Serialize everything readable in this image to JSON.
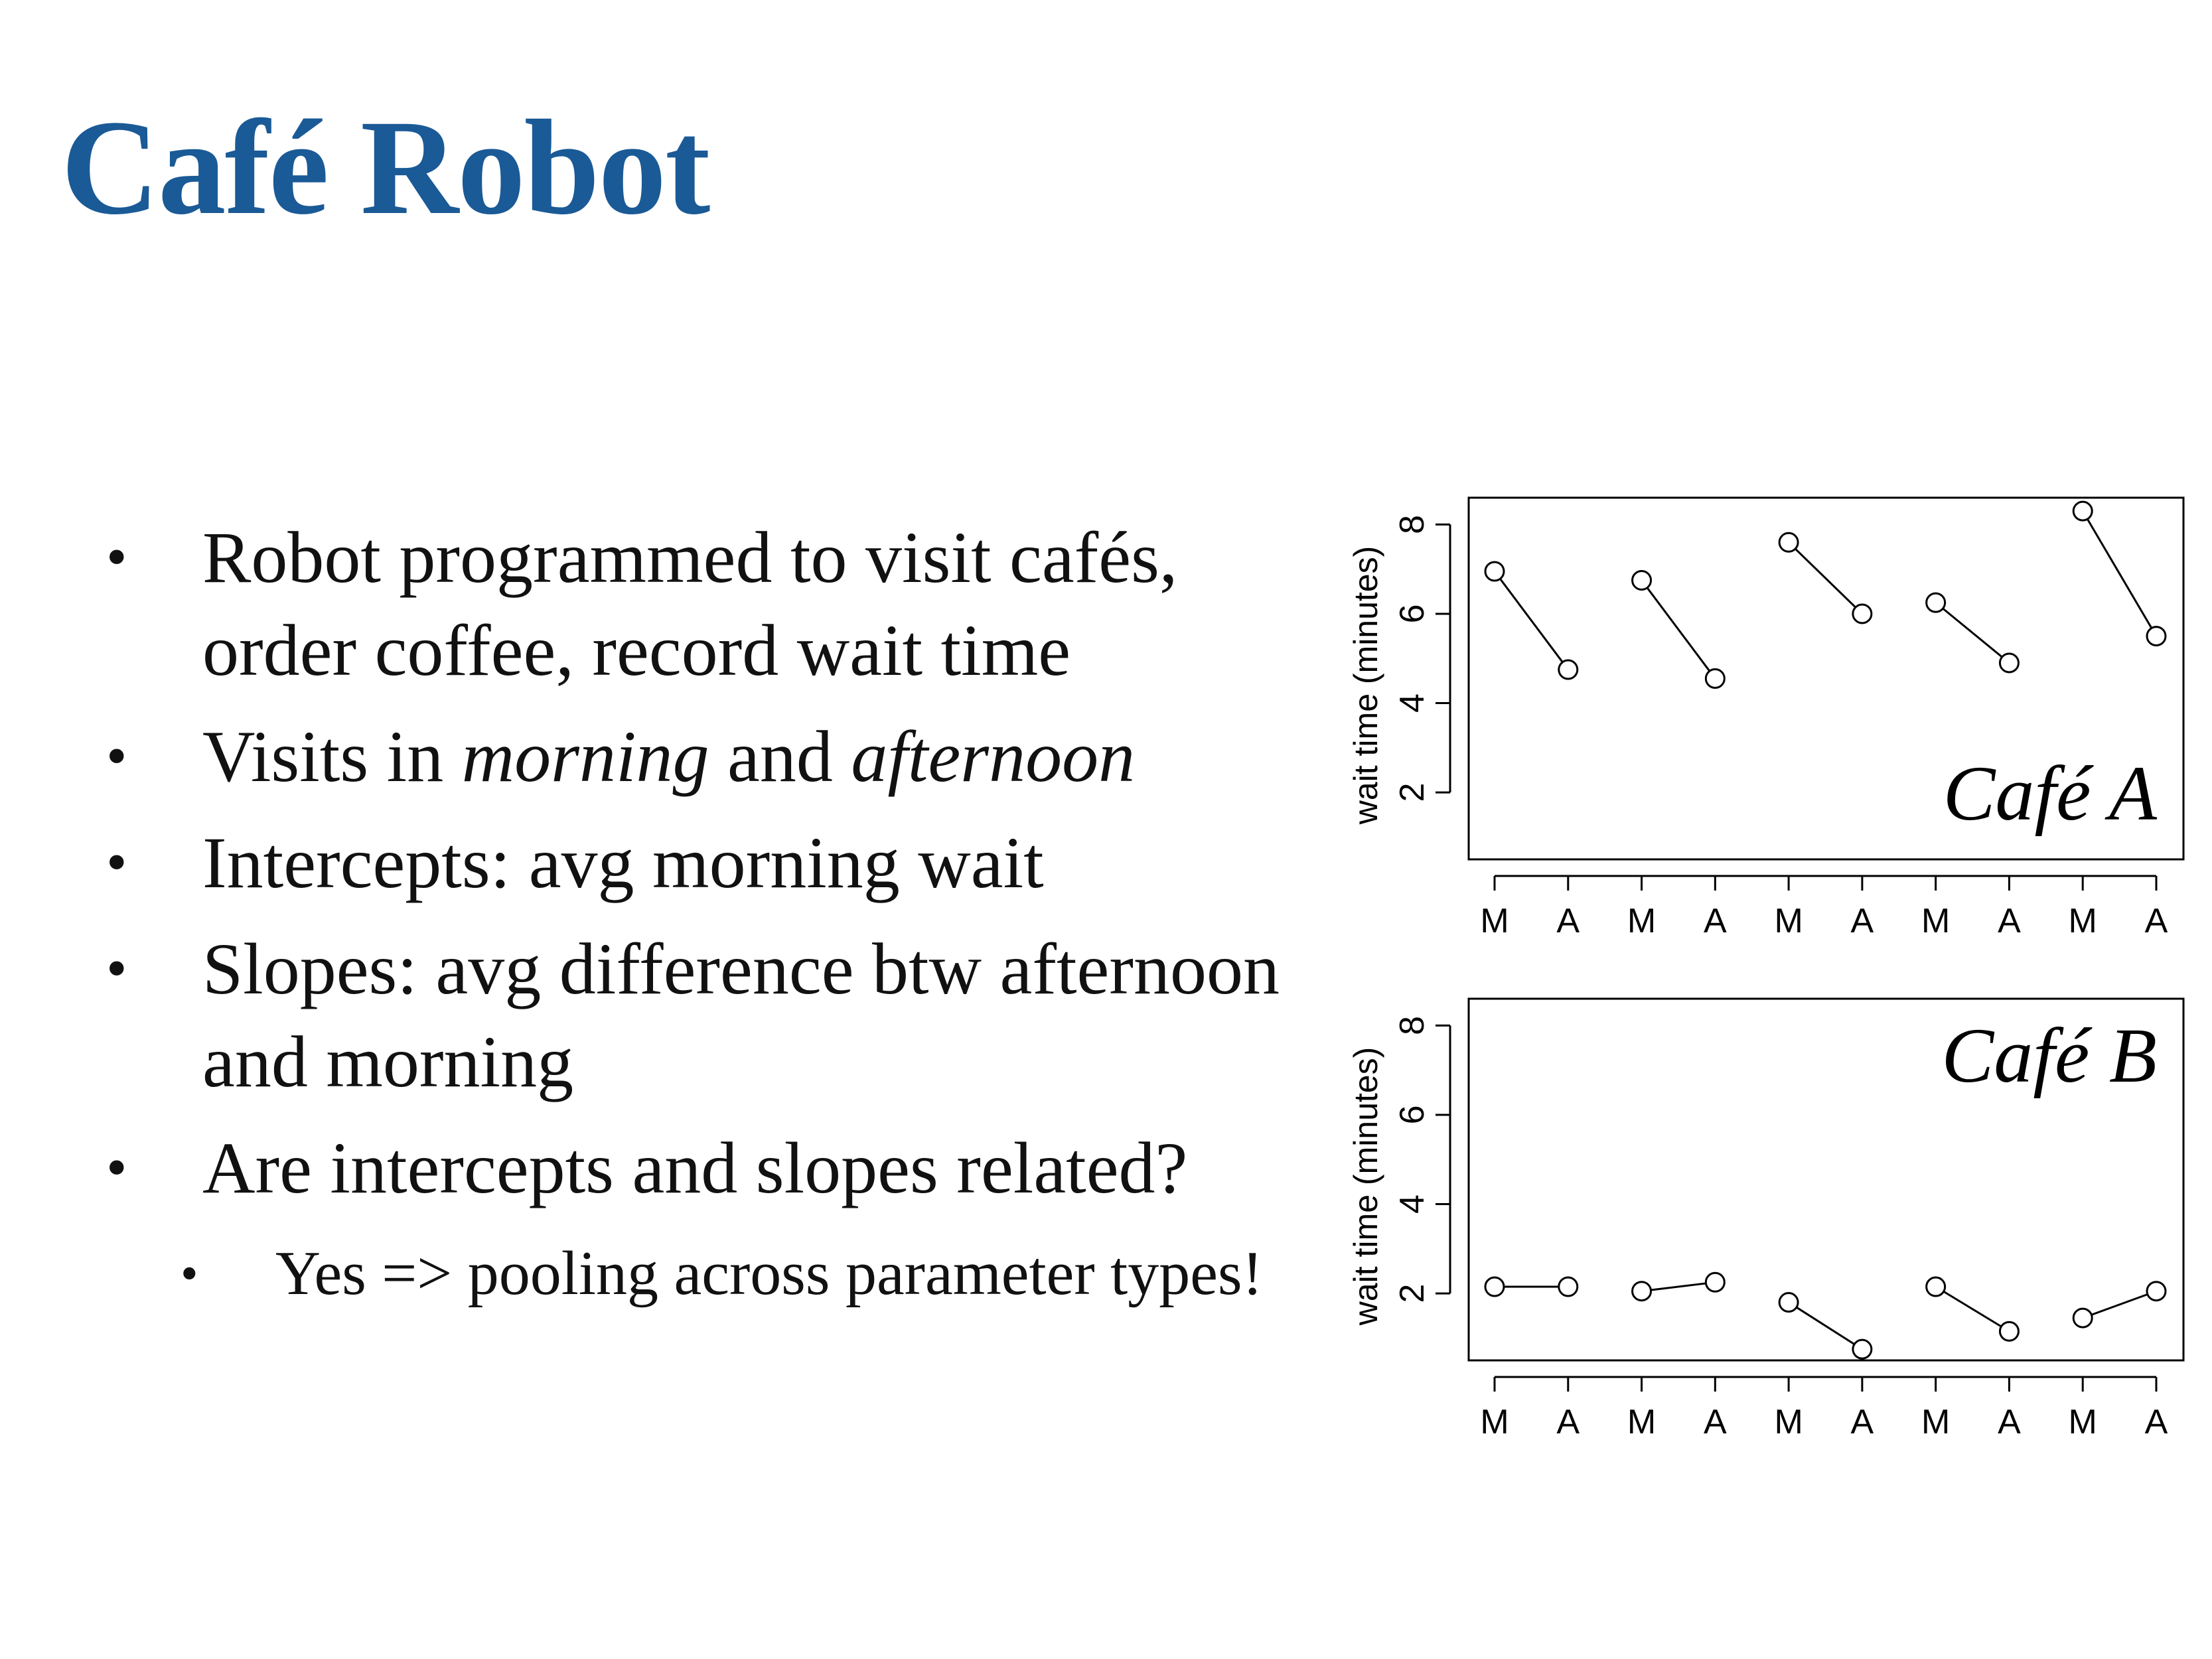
{
  "title": "Café Robot",
  "title_color": "#1a5a96",
  "bullets": [
    {
      "parts": [
        "Robot programmed to visit cafés, order coffee, record wait time"
      ]
    },
    {
      "parts": [
        "Visits in ",
        "morning",
        " and ",
        "afternoon"
      ],
      "italic": [
        1,
        3
      ]
    },
    {
      "parts": [
        "Intercepts: avg morning wait"
      ]
    },
    {
      "parts": [
        "Slopes: avg difference btw afternoon and morning"
      ]
    },
    {
      "parts": [
        "Are intercepts and slopes related?"
      ]
    },
    {
      "parts": [
        "Yes => pooling across parameter types!"
      ],
      "sub": true
    }
  ],
  "chart_data": [
    {
      "type": "line",
      "title": "Café A",
      "ylabel": "wait time (minutes)",
      "categories": [
        "M",
        "A",
        "M",
        "A",
        "M",
        "A",
        "M",
        "A",
        "M",
        "A"
      ],
      "ylim": [
        0.5,
        8.6
      ],
      "yticks": [
        2,
        4,
        6,
        8
      ],
      "pairs": [
        [
          6.95,
          4.75
        ],
        [
          6.75,
          4.55
        ],
        [
          7.6,
          6.0
        ],
        [
          6.25,
          4.9
        ],
        [
          8.3,
          5.5
        ]
      ]
    },
    {
      "type": "line",
      "title": "Café B",
      "ylabel": "wait time (minutes)",
      "categories": [
        "M",
        "A",
        "M",
        "A",
        "M",
        "A",
        "M",
        "A",
        "M",
        "A"
      ],
      "ylim": [
        0.5,
        8.6
      ],
      "yticks": [
        2,
        4,
        6,
        8
      ],
      "pairs": [
        [
          2.15,
          2.15
        ],
        [
          2.05,
          2.25
        ],
        [
          1.8,
          0.75
        ],
        [
          2.15,
          1.15
        ],
        [
          1.45,
          2.05
        ]
      ]
    }
  ]
}
